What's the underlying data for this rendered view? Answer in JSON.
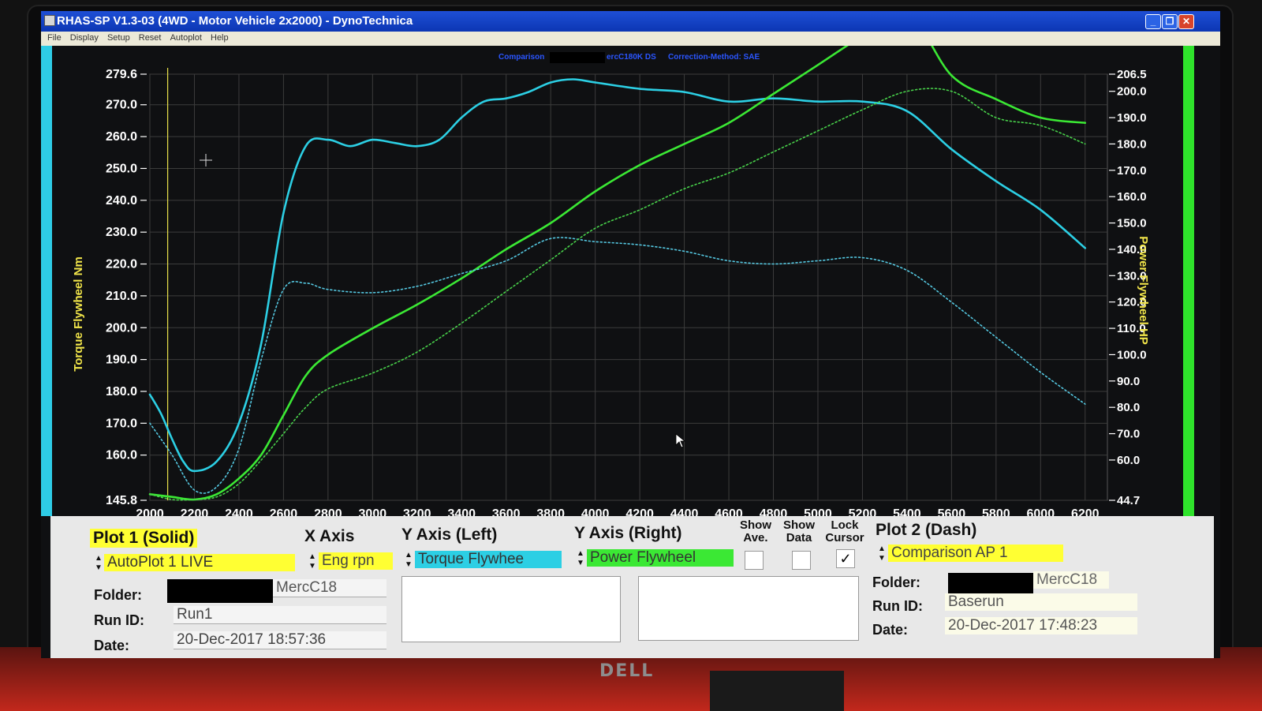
{
  "window": {
    "title": "RHAS-SP V1.3-03  (4WD - Motor Vehicle 2x2000) - DynoTechnica",
    "menu": [
      "File",
      "Display",
      "Setup",
      "Reset",
      "Autoplot",
      "Help"
    ]
  },
  "chart_header": {
    "comparison_label": "Comparison",
    "comparison_name": "ercC180K DS",
    "correction": "Correction-Method: SAE"
  },
  "chart_data": {
    "type": "line",
    "xlabel": "",
    "ylabel": "Torque Flywheel Nm",
    "y2label": "Power Flywheel HP",
    "xlim": [
      2000,
      6300
    ],
    "ylim": [
      145.8,
      279.6
    ],
    "y2lim": [
      44.7,
      206.5
    ],
    "x_ticks": [
      "2000",
      "2200",
      "2400",
      "2600",
      "2800",
      "3000",
      "3200",
      "3400",
      "3600",
      "3800",
      "4000",
      "4200",
      "4400",
      "4600",
      "4800",
      "5000",
      "5200",
      "5400",
      "5600",
      "5800",
      "6000",
      "6200"
    ],
    "y_ticks": [
      "279.6",
      "270.0",
      "260.0",
      "250.0",
      "240.0",
      "230.0",
      "220.0",
      "210.0",
      "200.0",
      "190.0",
      "180.0",
      "170.0",
      "160.0",
      "145.8"
    ],
    "y2_ticks": [
      "206.5",
      "200.0",
      "190.0",
      "180.0",
      "170.0",
      "160.0",
      "150.0",
      "140.0",
      "130.0",
      "120.0",
      "110.0",
      "100.0",
      "90.0",
      "80.0",
      "70.0",
      "60.0",
      "44.7"
    ],
    "grid": true,
    "cursor_rpm": 2080,
    "series": [
      {
        "name": "Torque Flywheel",
        "plot": "Plot 1 (Solid)",
        "axis": "left",
        "color": "#2ccfe4",
        "dash": false,
        "x": [
          2000,
          2050,
          2100,
          2150,
          2200,
          2300,
          2400,
          2500,
          2600,
          2700,
          2800,
          2900,
          3000,
          3100,
          3200,
          3300,
          3400,
          3500,
          3600,
          3700,
          3800,
          3900,
          4000,
          4200,
          4400,
          4600,
          4800,
          5000,
          5200,
          5400,
          5600,
          5800,
          6000,
          6200
        ],
        "y": [
          179,
          173,
          165,
          158,
          155,
          158,
          170,
          195,
          236,
          257,
          259,
          257,
          259,
          258,
          257,
          259,
          266,
          271,
          272,
          274,
          277,
          278,
          277,
          275,
          274,
          271,
          272,
          271,
          271,
          268,
          256,
          246,
          237,
          225
        ]
      },
      {
        "name": "Power Flywheel",
        "plot": "Plot 1 (Solid)",
        "axis": "right",
        "color": "#3be834",
        "dash": false,
        "x": [
          2000,
          2100,
          2200,
          2300,
          2400,
          2500,
          2600,
          2700,
          2800,
          3000,
          3200,
          3400,
          3600,
          3800,
          4000,
          4200,
          4400,
          4600,
          4800,
          5000,
          5200,
          5400,
          5600,
          5800,
          6000,
          6200
        ],
        "y": [
          47,
          46,
          45,
          47,
          53,
          62,
          77,
          92,
          100,
          110,
          119,
          129,
          140,
          150,
          162,
          172,
          180,
          188,
          199,
          210,
          221,
          230,
          206,
          197,
          190,
          188
        ]
      },
      {
        "name": "Comparison AP 1 Torque",
        "plot": "Plot 2 (Dash)",
        "axis": "left",
        "color": "#54c7e0",
        "dash": true,
        "x": [
          2000,
          2100,
          2200,
          2300,
          2400,
          2500,
          2600,
          2700,
          2800,
          3000,
          3200,
          3400,
          3600,
          3800,
          4000,
          4200,
          4400,
          4600,
          4800,
          5000,
          5200,
          5400,
          5600,
          5800,
          6000,
          6200
        ],
        "y": [
          170,
          160,
          149,
          150,
          162,
          190,
          212,
          214,
          212,
          211,
          213,
          217,
          221,
          228,
          227,
          226,
          224,
          221,
          220,
          221,
          222,
          218,
          208,
          197,
          186,
          176
        ]
      },
      {
        "name": "Comparison AP 1 Power",
        "plot": "Plot 2 (Dash)",
        "axis": "right",
        "color": "#48d14a",
        "dash": true,
        "x": [
          2000,
          2100,
          2200,
          2300,
          2400,
          2500,
          2600,
          2700,
          2800,
          3000,
          3200,
          3400,
          3600,
          3800,
          4000,
          4200,
          4400,
          4600,
          4800,
          5000,
          5200,
          5400,
          5600,
          5800,
          6000,
          6200
        ],
        "y": [
          47,
          45,
          45,
          46,
          51,
          60,
          70,
          80,
          87,
          93,
          101,
          112,
          124,
          136,
          148,
          155,
          163,
          169,
          177,
          185,
          193,
          200,
          200,
          190,
          187,
          180
        ]
      }
    ]
  },
  "panel": {
    "plot1": {
      "heading": "Plot 1 (Solid)",
      "source": "AutoPlot 1 LIVE",
      "folder_label": "Folder:",
      "folder_suffix": "MercC18",
      "runid_label": "Run ID:",
      "runid": "Run1",
      "date_label": "Date:",
      "date": "20-Dec-2017  18:57:36"
    },
    "xaxis": {
      "heading": "X Axis",
      "value": "Eng rpn"
    },
    "yleft": {
      "heading": "Y Axis (Left)",
      "value": "Torque Flywhee"
    },
    "yright": {
      "heading": "Y Axis (Right)",
      "value": "Power Flywheel"
    },
    "show_ave": "Show Ave.",
    "show_data": "Show Data",
    "lock_cursor": "Lock Cursor",
    "checkmark": "✓",
    "plot2": {
      "heading": "Plot 2 (Dash)",
      "source": "Comparison AP 1",
      "folder_label": "Folder:",
      "folder_suffix": "MercC18",
      "runid_label": "Run ID:",
      "runid": "Baserun",
      "date_label": "Date:",
      "date": "20-Dec-2017  17:48:23"
    }
  },
  "colors": {
    "torque": "#2ccfe4",
    "power": "#3be834",
    "highlight": "#ffff33"
  },
  "monitor_brand": "DELL"
}
